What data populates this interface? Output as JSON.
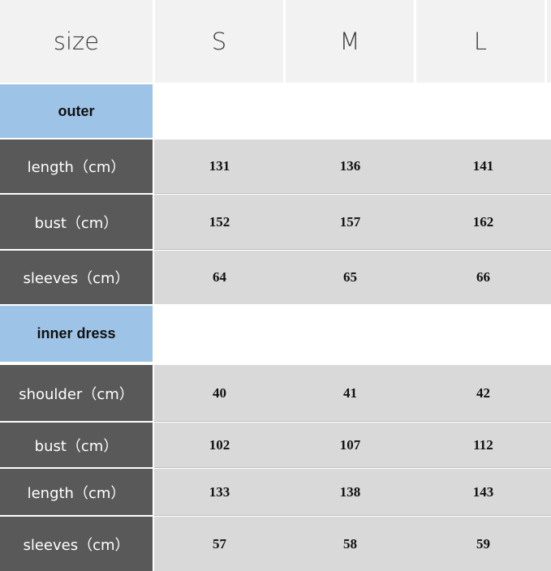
{
  "header": {
    "size_label": "size",
    "sizes": [
      "S",
      "M",
      "L"
    ]
  },
  "sections": [
    {
      "title": "outer",
      "rows": [
        {
          "label": "length（cm）",
          "values": [
            "131",
            "136",
            "141"
          ]
        },
        {
          "label": "bust（cm）",
          "values": [
            "152",
            "157",
            "162"
          ]
        },
        {
          "label": "sleeves（cm）",
          "values": [
            "64",
            "65",
            "66"
          ]
        }
      ]
    },
    {
      "title": "inner dress",
      "rows": [
        {
          "label": "shoulder（cm）",
          "values": [
            "40",
            "41",
            "42"
          ]
        },
        {
          "label": "bust（cm）",
          "values": [
            "102",
            "107",
            "112"
          ]
        },
        {
          "label": "length（cm）",
          "values": [
            "133",
            "138",
            "143"
          ]
        },
        {
          "label": "sleeves（cm）",
          "values": [
            "57",
            "58",
            "59"
          ]
        }
      ]
    }
  ],
  "colors": {
    "header_bg": "#f2f2f2",
    "section_bg": "#9dc3e6",
    "label_bg": "#595959",
    "value_bg": "#d9d9d9"
  },
  "chart_data": {
    "type": "table",
    "columns": [
      "size",
      "S",
      "M",
      "L"
    ],
    "groups": [
      {
        "name": "outer",
        "rows": [
          [
            "length（cm）",
            131,
            136,
            141
          ],
          [
            "bust（cm）",
            152,
            157,
            162
          ],
          [
            "sleeves（cm）",
            64,
            65,
            66
          ]
        ]
      },
      {
        "name": "inner dress",
        "rows": [
          [
            "shoulder（cm）",
            40,
            41,
            42
          ],
          [
            "bust（cm）",
            102,
            107,
            112
          ],
          [
            "length（cm）",
            133,
            138,
            143
          ],
          [
            "sleeves（cm）",
            57,
            58,
            59
          ]
        ]
      }
    ]
  }
}
